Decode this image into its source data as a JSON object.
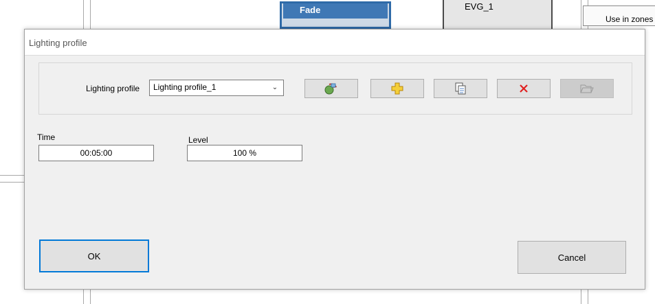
{
  "background": {
    "fade_label": "Fade",
    "evg_label": "EVG_1",
    "zones_label": "Use in zones"
  },
  "dialog": {
    "title": "Lighting profile",
    "profile_label": "Lighting profile",
    "profile_value": "Lighting profile_1",
    "toolbar": {
      "icons": [
        "rename-icon",
        "add-icon",
        "copy-icon",
        "delete-icon",
        "open-folder-icon"
      ],
      "accent_colors": {
        "add": "#f0c020",
        "delete": "#e02020"
      }
    },
    "time_label": "Time",
    "time_value": "00:05:00",
    "level_label": "Level",
    "level_value": "100 %",
    "ok_label": "OK",
    "cancel_label": "Cancel",
    "focus_color": "#0078d7"
  }
}
